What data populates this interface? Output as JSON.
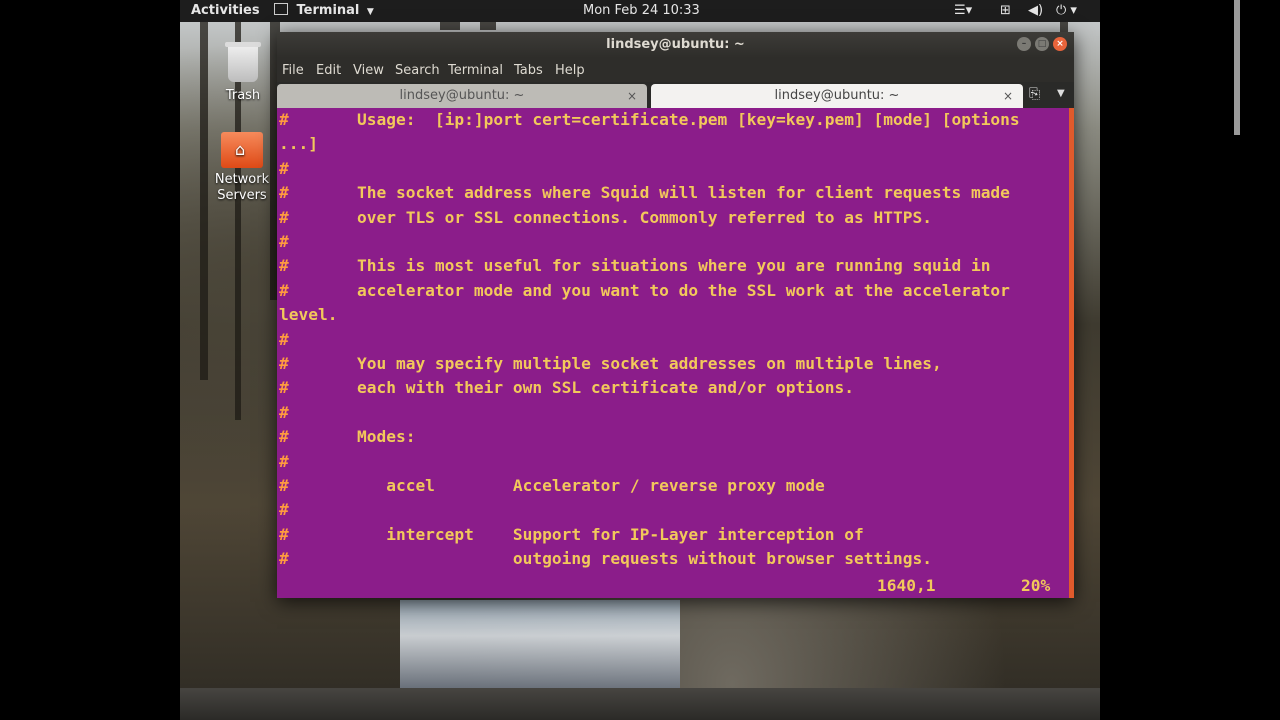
{
  "top_panel": {
    "activities": "Activities",
    "app_name": "Terminal",
    "app_menu_icon": "chevron-down-icon",
    "clock": "Mon Feb 24  10:33",
    "tray_icons": [
      "menu-icon",
      "network-icon",
      "volume-icon",
      "power-icon"
    ]
  },
  "desktop": {
    "icons": [
      {
        "label": "Trash",
        "icon": "trash-icon"
      },
      {
        "label": "Network\nServers",
        "icon": "folder-network-icon"
      }
    ]
  },
  "window": {
    "title": "lindsey@ubuntu: ~",
    "menu": [
      "File",
      "Edit",
      "View",
      "Search",
      "Terminal",
      "Tabs",
      "Help"
    ],
    "tabs": [
      {
        "label": "lindsey@ubuntu: ~",
        "active": false
      },
      {
        "label": "lindsey@ubuntu: ~",
        "active": true
      }
    ],
    "tab_close_glyph": "×",
    "colors": {
      "background": "#8b1d8a",
      "text": "#f2c85b",
      "hash": "#ff9b3f",
      "close": "#e9643b"
    }
  },
  "terminal": {
    "lines": [
      "        Usage:  [ip:]port cert=certificate.pem [key=key.pem] [mode] [options",
      "...]",
      "",
      "        The socket address where Squid will listen for client requests made",
      "        over TLS or SSL connections. Commonly referred to as HTTPS.",
      "",
      "        This is most useful for situations where you are running squid in",
      "        accelerator mode and you want to do the SSL work at the accelerator",
      "level.",
      "",
      "        You may specify multiple socket addresses on multiple lines,",
      "        each with their own SSL certificate and/or options.",
      "",
      "        Modes:",
      "",
      "           accel        Accelerator / reverse proxy mode",
      "",
      "           intercept    Support for IP-Layer interception of",
      "                        outgoing requests without browser settings."
    ],
    "hash_rows": [
      0,
      2,
      3,
      4,
      5,
      6,
      7,
      9,
      10,
      11,
      12,
      13,
      14,
      15,
      16,
      17,
      18
    ],
    "hash_char": "#",
    "status_position": "1640,1",
    "status_percent": "20%"
  }
}
